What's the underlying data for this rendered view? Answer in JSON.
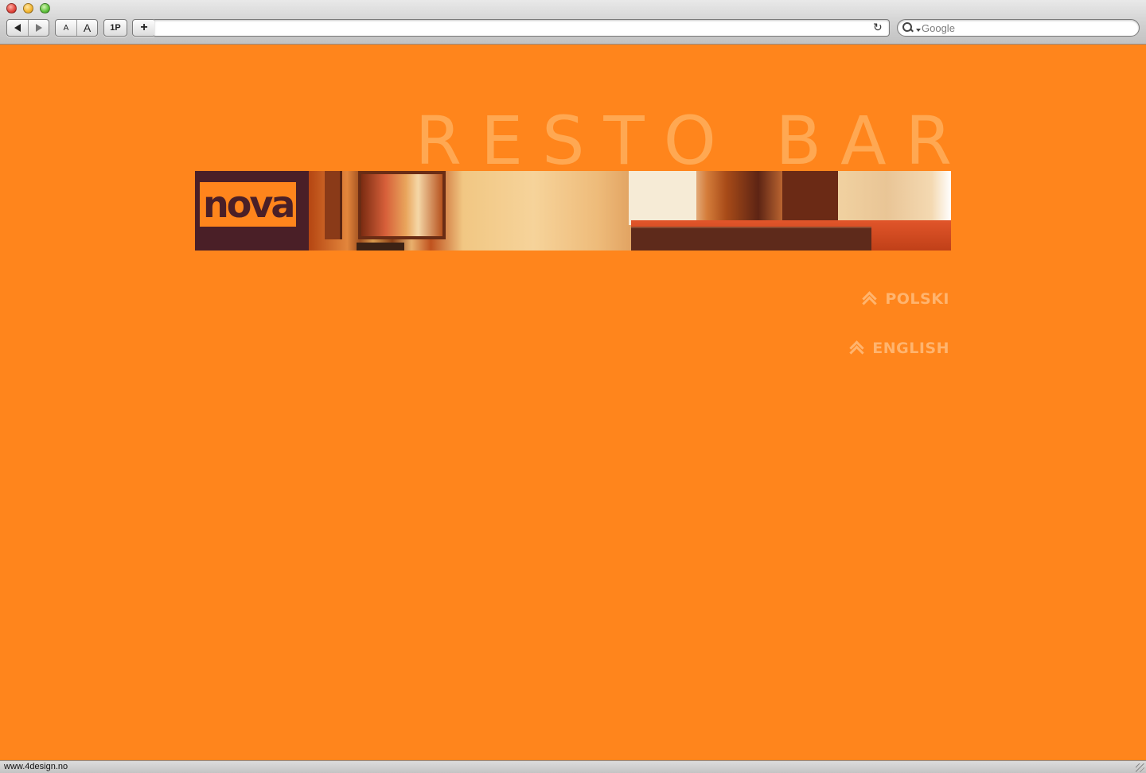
{
  "browser": {
    "toolbar": {
      "back": "back",
      "forward": "forward",
      "text_smaller": "A",
      "text_bigger": "A",
      "reader": "1P",
      "add_bookmark": "+"
    },
    "address": {
      "value": "",
      "placeholder": ""
    },
    "search": {
      "placeholder": "Google"
    },
    "status_text": "www.4design.no"
  },
  "page": {
    "tagline": "RESTO BAR",
    "logo_text": "nova",
    "languages": [
      {
        "label": "POLSKI"
      },
      {
        "label": "ENGLISH"
      }
    ]
  },
  "colors": {
    "background": "#ff851c",
    "tagline": "#ffa852",
    "logo_box": "#4a1f27",
    "link": "#ffb46e"
  },
  "icons": {
    "back": "triangle-left-icon",
    "forward": "triangle-right-icon",
    "reload": "reload-icon",
    "search": "magnifier-icon",
    "language_link": "double-chevron-up-icon"
  }
}
